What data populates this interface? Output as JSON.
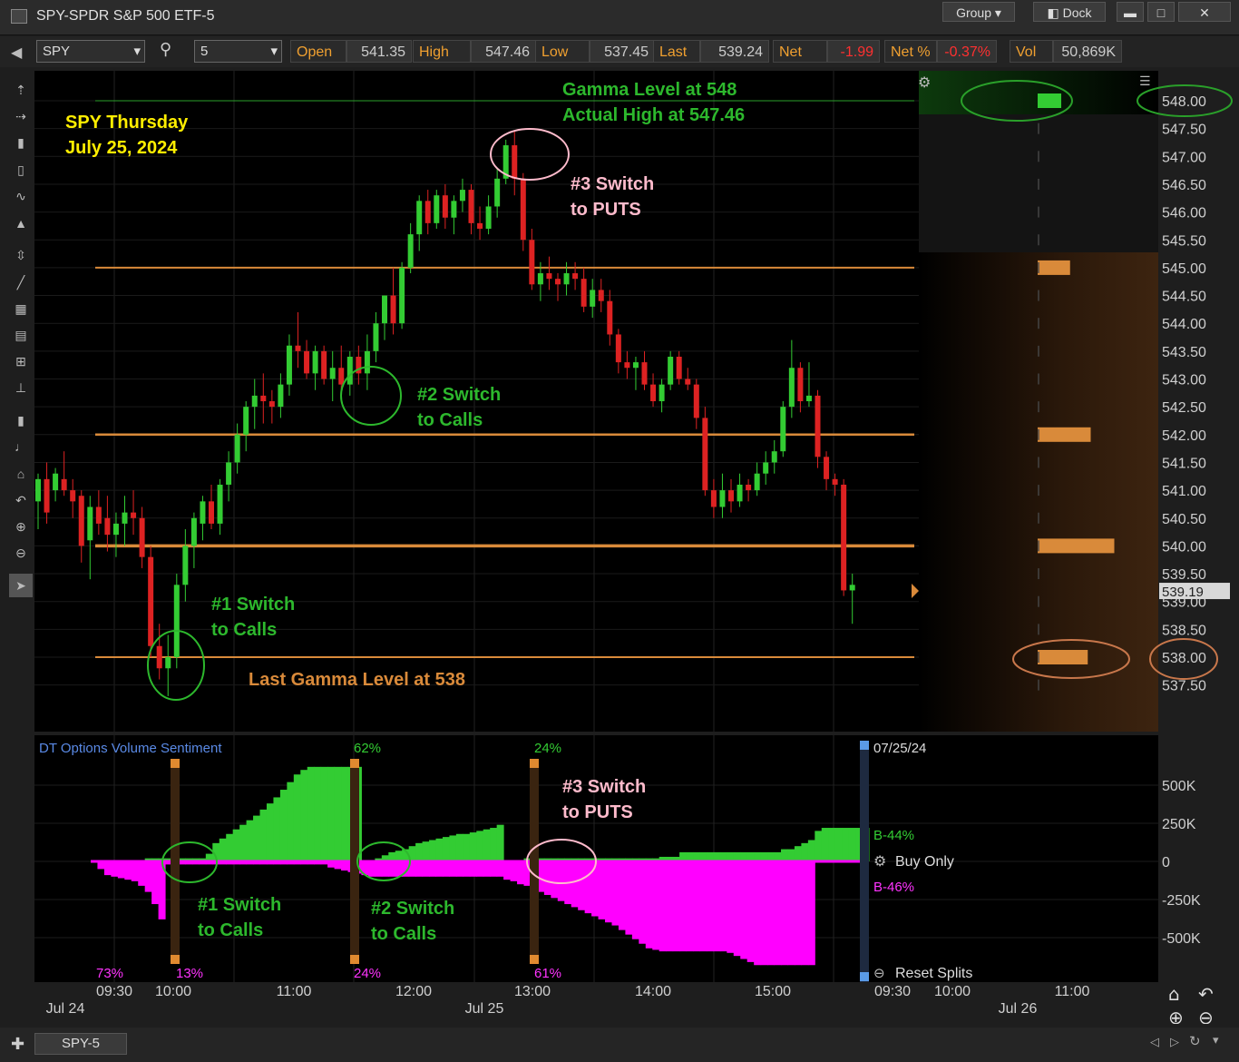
{
  "window": {
    "title": "SPY-SPDR S&P 500 ETF-5",
    "group_label": "Group",
    "dock_label": "Dock",
    "minimize": "▬",
    "maximize": "□",
    "close": "✕"
  },
  "toolbar": {
    "symbol": "SPY",
    "interval": "5",
    "quote": [
      {
        "label": "Open",
        "value": "541.35"
      },
      {
        "label": "High",
        "value": "547.46"
      },
      {
        "label": "Low",
        "value": "537.45"
      },
      {
        "label": "Last",
        "value": "539.24"
      },
      {
        "label": "Net",
        "value": "-1.99"
      },
      {
        "label": "Net %",
        "value": "-0.37%"
      },
      {
        "label": "Vol",
        "value": "50,869K"
      }
    ]
  },
  "tabs": [
    {
      "label": "SPY-5"
    }
  ],
  "colors": {
    "bg": "#000000",
    "up": "#33cc33",
    "down": "#dd2222",
    "gamma": "#d98a3a",
    "sent_pos": "#33cc33",
    "sent_neg": "#ff00ff",
    "annot_green": "#2db82d",
    "annot_yellow": "#ffee00",
    "annot_pink": "#ffbbcc"
  },
  "chart_data": [
    {
      "type": "candlestick",
      "title": "SPY Thursday July 25, 2024",
      "ylim": [
        537.0,
        548.4
      ],
      "y_ticks": [
        "548.00",
        "547.50",
        "547.00",
        "546.50",
        "546.00",
        "545.50",
        "545.00",
        "544.50",
        "544.00",
        "543.50",
        "543.00",
        "542.50",
        "542.00",
        "541.50",
        "541.00",
        "540.50",
        "540.00",
        "539.50",
        "539.00",
        "538.50",
        "538.00",
        "537.50"
      ],
      "price_marker": "539.19",
      "horizontal_levels": [
        548,
        545,
        542,
        540,
        538
      ],
      "gamma_bars": [
        {
          "price": 548,
          "strength": 0.4,
          "color": "#33cc33"
        },
        {
          "price": 545,
          "strength": 0.55,
          "color": "#d98a3a"
        },
        {
          "price": 542,
          "strength": 0.9,
          "color": "#d98a3a"
        },
        {
          "price": 540,
          "strength": 1.3,
          "color": "#d98a3a"
        },
        {
          "price": 538,
          "strength": 0.85,
          "color": "#d98a3a"
        }
      ],
      "circled_labels": [
        "548.00",
        "538.00"
      ],
      "candles": [
        [
          540.8,
          541.3,
          540.3,
          541.2
        ],
        [
          541.2,
          541.5,
          540.4,
          540.6
        ],
        [
          541.0,
          541.4,
          540.8,
          541.3
        ],
        [
          541.2,
          541.7,
          540.9,
          541.0
        ],
        [
          541.0,
          541.2,
          540.5,
          540.8
        ],
        [
          540.9,
          541.0,
          539.7,
          540.0
        ],
        [
          540.1,
          540.9,
          539.4,
          540.7
        ],
        [
          540.7,
          541.0,
          540.2,
          540.4
        ],
        [
          540.5,
          540.9,
          539.9,
          540.2
        ],
        [
          540.2,
          540.6,
          539.8,
          540.4
        ],
        [
          540.4,
          540.9,
          540.0,
          540.6
        ],
        [
          540.6,
          541.0,
          540.2,
          540.5
        ],
        [
          540.5,
          540.7,
          539.6,
          539.8
        ],
        [
          539.8,
          540.0,
          538.0,
          538.2
        ],
        [
          538.2,
          538.6,
          537.6,
          537.8
        ],
        [
          537.8,
          538.4,
          537.3,
          538.0
        ],
        [
          538.0,
          539.5,
          537.8,
          539.3
        ],
        [
          539.3,
          540.3,
          539.0,
          540.0
        ],
        [
          540.0,
          540.6,
          539.6,
          540.5
        ],
        [
          540.4,
          540.9,
          540.1,
          540.8
        ],
        [
          540.8,
          541.1,
          540.3,
          540.4
        ],
        [
          540.4,
          541.2,
          540.2,
          541.1
        ],
        [
          541.1,
          541.7,
          540.8,
          541.5
        ],
        [
          541.5,
          542.2,
          541.3,
          542.0
        ],
        [
          542.0,
          542.6,
          541.7,
          542.5
        ],
        [
          542.5,
          543.0,
          542.1,
          542.7
        ],
        [
          542.7,
          543.1,
          542.2,
          542.6
        ],
        [
          542.6,
          542.8,
          542.2,
          542.5
        ],
        [
          542.5,
          543.1,
          542.3,
          542.9
        ],
        [
          542.9,
          543.8,
          542.7,
          543.6
        ],
        [
          543.6,
          544.2,
          543.2,
          543.5
        ],
        [
          543.5,
          543.7,
          543.0,
          543.1
        ],
        [
          543.1,
          543.6,
          542.8,
          543.5
        ],
        [
          543.5,
          543.6,
          542.9,
          543.0
        ],
        [
          543.0,
          543.5,
          542.6,
          543.2
        ],
        [
          543.2,
          543.6,
          542.8,
          542.9
        ],
        [
          542.9,
          543.5,
          542.7,
          543.4
        ],
        [
          543.4,
          543.6,
          542.9,
          543.1
        ],
        [
          543.1,
          543.8,
          542.8,
          543.5
        ],
        [
          543.5,
          544.2,
          543.3,
          544.0
        ],
        [
          544.0,
          544.5,
          543.7,
          544.5
        ],
        [
          544.5,
          545.0,
          543.8,
          544.0
        ],
        [
          544.0,
          545.1,
          543.9,
          545.0
        ],
        [
          545.0,
          545.8,
          544.9,
          545.6
        ],
        [
          545.6,
          546.3,
          545.3,
          546.2
        ],
        [
          546.2,
          546.4,
          545.6,
          545.8
        ],
        [
          545.8,
          546.4,
          545.7,
          546.3
        ],
        [
          546.3,
          546.5,
          545.7,
          545.9
        ],
        [
          545.9,
          546.3,
          545.6,
          546.2
        ],
        [
          546.2,
          546.6,
          546.0,
          546.4
        ],
        [
          546.4,
          546.5,
          545.6,
          545.8
        ],
        [
          545.8,
          546.1,
          545.5,
          545.7
        ],
        [
          545.7,
          546.3,
          545.6,
          546.1
        ],
        [
          546.1,
          546.8,
          545.9,
          546.6
        ],
        [
          546.6,
          547.3,
          546.5,
          547.2
        ],
        [
          547.2,
          547.46,
          546.3,
          546.6
        ],
        [
          546.6,
          546.7,
          545.3,
          545.5
        ],
        [
          545.5,
          545.7,
          544.6,
          544.7
        ],
        [
          544.7,
          545.1,
          544.4,
          544.9
        ],
        [
          544.9,
          545.2,
          544.6,
          544.8
        ],
        [
          544.8,
          544.9,
          544.4,
          544.7
        ],
        [
          544.7,
          545.1,
          544.5,
          544.9
        ],
        [
          544.9,
          545.1,
          544.6,
          544.8
        ],
        [
          544.8,
          545.0,
          544.2,
          544.3
        ],
        [
          544.3,
          544.8,
          544.1,
          544.6
        ],
        [
          544.6,
          544.8,
          544.2,
          544.4
        ],
        [
          544.4,
          544.6,
          543.6,
          543.8
        ],
        [
          543.8,
          543.9,
          543.1,
          543.3
        ],
        [
          543.3,
          543.5,
          543.0,
          543.2
        ],
        [
          543.2,
          543.4,
          542.8,
          543.3
        ],
        [
          543.3,
          543.5,
          542.8,
          542.9
        ],
        [
          542.9,
          543.1,
          542.5,
          542.6
        ],
        [
          542.6,
          543.0,
          542.4,
          542.9
        ],
        [
          542.9,
          543.5,
          542.8,
          543.4
        ],
        [
          543.4,
          543.5,
          542.9,
          543.0
        ],
        [
          543.0,
          543.2,
          542.8,
          542.9
        ],
        [
          542.9,
          543.0,
          542.1,
          542.3
        ],
        [
          542.3,
          542.5,
          540.9,
          541.0
        ],
        [
          541.0,
          541.2,
          540.5,
          540.7
        ],
        [
          540.7,
          541.3,
          540.5,
          541.0
        ],
        [
          541.0,
          541.2,
          540.6,
          540.8
        ],
        [
          540.8,
          541.3,
          540.7,
          541.1
        ],
        [
          541.1,
          541.2,
          540.8,
          541.0
        ],
        [
          541.0,
          541.5,
          540.9,
          541.3
        ],
        [
          541.3,
          541.7,
          541.1,
          541.5
        ],
        [
          541.5,
          541.9,
          541.3,
          541.7
        ],
        [
          541.7,
          542.6,
          541.6,
          542.5
        ],
        [
          542.5,
          543.7,
          542.3,
          543.2
        ],
        [
          543.2,
          543.3,
          542.4,
          542.6
        ],
        [
          542.6,
          543.3,
          542.5,
          542.7
        ],
        [
          542.7,
          542.8,
          541.4,
          541.6
        ],
        [
          541.6,
          541.7,
          541.0,
          541.2
        ],
        [
          541.2,
          541.3,
          540.9,
          541.1
        ],
        [
          541.1,
          541.2,
          539.1,
          539.2
        ],
        [
          539.2,
          539.5,
          538.6,
          539.3
        ]
      ]
    },
    {
      "type": "area",
      "title": "DT Options Volume Sentiment",
      "y_ticks": [
        "500K",
        "250K",
        "0",
        "-250K",
        "-500K"
      ],
      "ylim": [
        -700000,
        700000
      ],
      "x_labels": [
        "09:30",
        "10:00",
        "11:00",
        "12:00",
        "13:00",
        "14:00",
        "15:00",
        "09:30",
        "10:00",
        "11:00"
      ],
      "date_labels": [
        "Jul 24",
        "Jul 25",
        "Jul 26"
      ],
      "positive_series": [
        0,
        0,
        0,
        0,
        0,
        0,
        0,
        0,
        20,
        20,
        20,
        20,
        20,
        20,
        20,
        20,
        20,
        50,
        120,
        150,
        180,
        210,
        240,
        270,
        300,
        340,
        380,
        420,
        470,
        520,
        570,
        600,
        620,
        620,
        620,
        620,
        620,
        620,
        620,
        620,
        0,
        0,
        20,
        40,
        60,
        70,
        80,
        100,
        120,
        130,
        140,
        150,
        160,
        170,
        180,
        180,
        190,
        200,
        210,
        220,
        240,
        0,
        0,
        0,
        20,
        20,
        20,
        20,
        20,
        20,
        20,
        20,
        20,
        20,
        20,
        20,
        20,
        20,
        20,
        20,
        20,
        20,
        20,
        20,
        30,
        30,
        30,
        60,
        60,
        60,
        60,
        60,
        60,
        60,
        60,
        60,
        60,
        60,
        60,
        60,
        60,
        60,
        80,
        80,
        100,
        120,
        140,
        200,
        220,
        220,
        220,
        220,
        220,
        220,
        220
      ],
      "negative_series": [
        0,
        -50,
        -90,
        -100,
        -110,
        -120,
        -130,
        -160,
        -200,
        -280,
        -380,
        -20,
        -20,
        -20,
        -20,
        -20,
        -20,
        -20,
        -20,
        -20,
        -20,
        -20,
        -20,
        -20,
        -20,
        -20,
        -20,
        -20,
        -20,
        -20,
        -20,
        -20,
        -20,
        -20,
        -20,
        -40,
        -50,
        -60,
        -70,
        -80,
        -90,
        -100,
        -100,
        -100,
        -100,
        -100,
        -100,
        -100,
        -100,
        -100,
        -100,
        -100,
        -100,
        -100,
        -100,
        -100,
        -100,
        -100,
        -100,
        -100,
        -100,
        -120,
        -130,
        -150,
        -160,
        -180,
        -200,
        -220,
        -240,
        -260,
        -280,
        -300,
        -320,
        -340,
        -360,
        -380,
        -400,
        -420,
        -450,
        -480,
        -510,
        -540,
        -570,
        -580,
        -590,
        -590,
        -590,
        -590,
        -590,
        -590,
        -590,
        -590,
        -590,
        -590,
        -600,
        -620,
        -640,
        -660,
        -680,
        -680,
        -680,
        -680,
        -680,
        -680,
        -680,
        -680,
        -680
      ],
      "top_percents": [
        {
          "text": "62%",
          "color": "#33cc33"
        },
        {
          "text": "24%",
          "color": "#33cc33"
        }
      ],
      "bottom_percents": [
        {
          "text": "73%"
        },
        {
          "text": "13%"
        },
        {
          "text": "24%"
        },
        {
          "text": "61%"
        }
      ],
      "right_date": "07/25/24",
      "b_pos": "B-44%",
      "b_neg": "B-46%",
      "buy_only": "Buy Only",
      "reset_splits": "Reset Splits"
    }
  ],
  "annotations": {
    "title_line1": "SPY Thursday",
    "title_line2": "July 25, 2024",
    "gamma548_line1": "Gamma Level at 548",
    "gamma548_line2": "Actual High at 547.46",
    "sw3_line1": "#3 Switch",
    "sw3_line2": "to PUTS",
    "sw2_line1": "#2 Switch",
    "sw2_line2": "to Calls",
    "sw1_line1": "#1 Switch",
    "sw1_line2": "to Calls",
    "gamma538": "Last Gamma Level at 538",
    "low_sw1_line1": "#1 Switch",
    "low_sw1_line2": "to Calls",
    "low_sw2_line1": "#2 Switch",
    "low_sw2_line2": "to Calls",
    "low_sw3_line1": "#3 Switch",
    "low_sw3_line2": "to PUTS"
  }
}
